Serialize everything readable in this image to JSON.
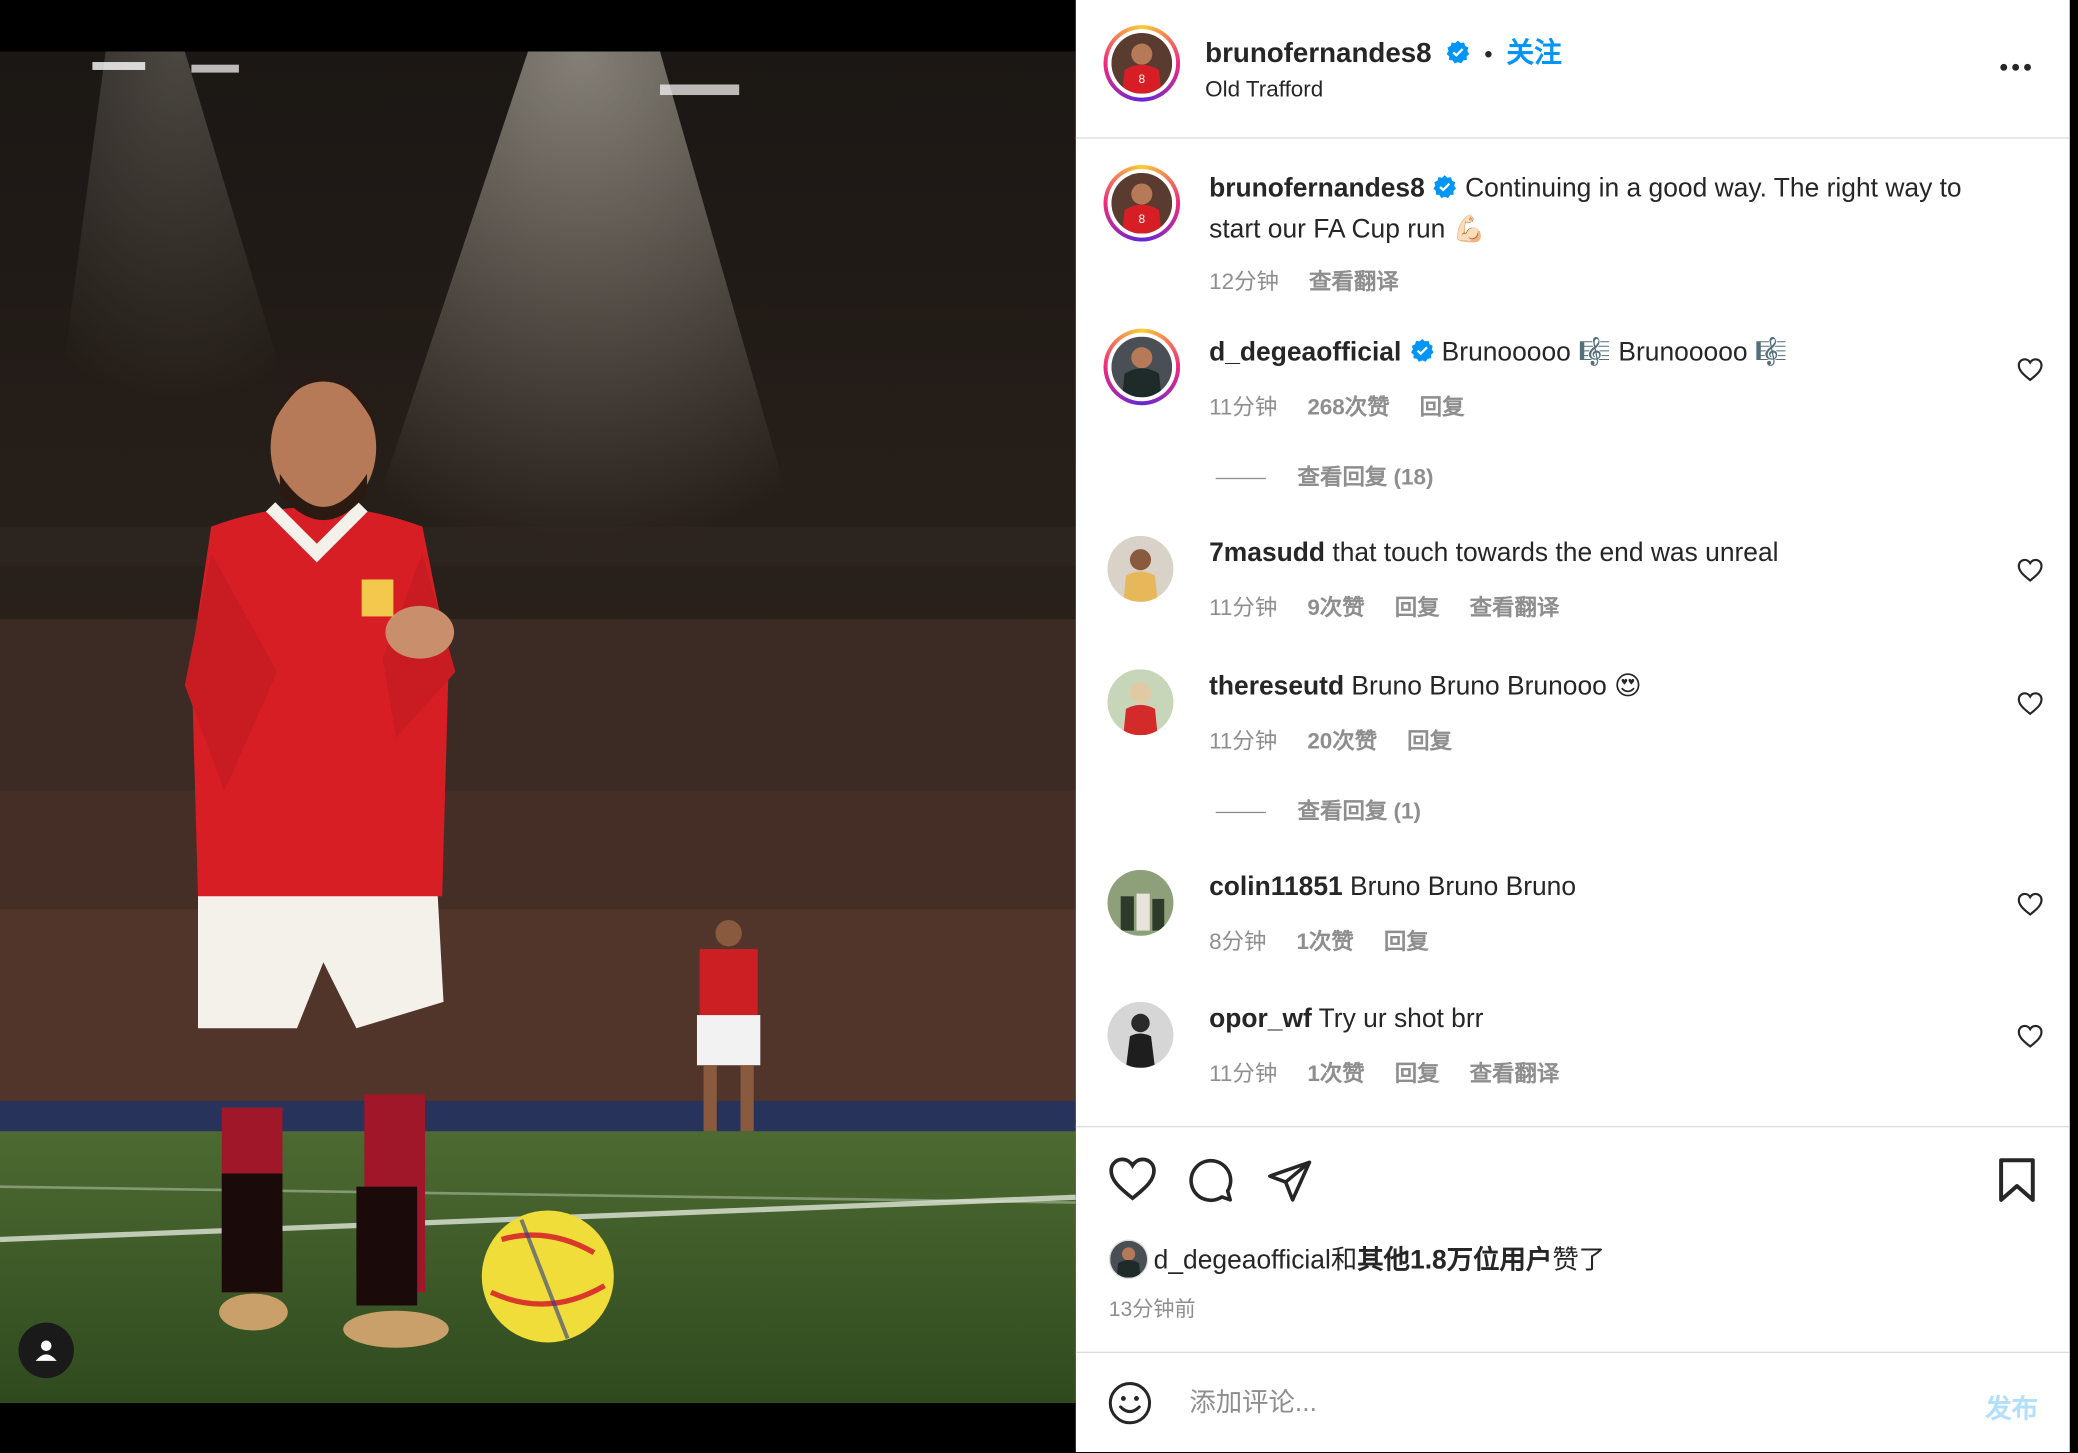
{
  "header": {
    "username": "brunofernandes8",
    "separator": "•",
    "follow_label": "关注",
    "location": "Old Trafford",
    "more_icon": "more-horizontal-icon"
  },
  "caption": {
    "username": "brunofernandes8",
    "text": "Continuing in a good way. The right way to start our FA Cup run",
    "emoji": "💪🏻",
    "time": "12分钟",
    "translate": "查看翻译"
  },
  "comments": [
    {
      "username": "d_degeaofficial",
      "verified": true,
      "text": "Brunooooo 🎼 Brunooooo 🎼",
      "time": "11分钟",
      "likes": "268次赞",
      "reply": "回复",
      "view_replies": "查看回复 (18)"
    },
    {
      "username": "7masudd",
      "text": "that touch towards the end was unreal",
      "time": "11分钟",
      "likes": "9次赞",
      "reply": "回复",
      "translate": "查看翻译"
    },
    {
      "username": "thereseutd",
      "text": "Bruno Bruno Brunooo 😍",
      "time": "11分钟",
      "likes": "20次赞",
      "reply": "回复",
      "view_replies": "查看回复 (1)"
    },
    {
      "username": "colin11851",
      "text": "Bruno Bruno Bruno",
      "time": "8分钟",
      "likes": "1次赞",
      "reply": "回复"
    },
    {
      "username": "opor_wf",
      "text": "Try ur shot brr",
      "time": "11分钟",
      "likes": "1次赞",
      "reply": "回复",
      "translate": "查看翻译"
    }
  ],
  "likes_line": {
    "user": "d_degeaofficial",
    "and": "和",
    "others": "其他1.8万位用户",
    "suffix": "赞了"
  },
  "post_time": "13分钟前",
  "add_comment": {
    "placeholder": "添加评论...",
    "post_label": "发布"
  },
  "colors": {
    "accent": "#0095f6",
    "post_disabled": "#b2dffc",
    "muted": "#8e8e8e"
  }
}
